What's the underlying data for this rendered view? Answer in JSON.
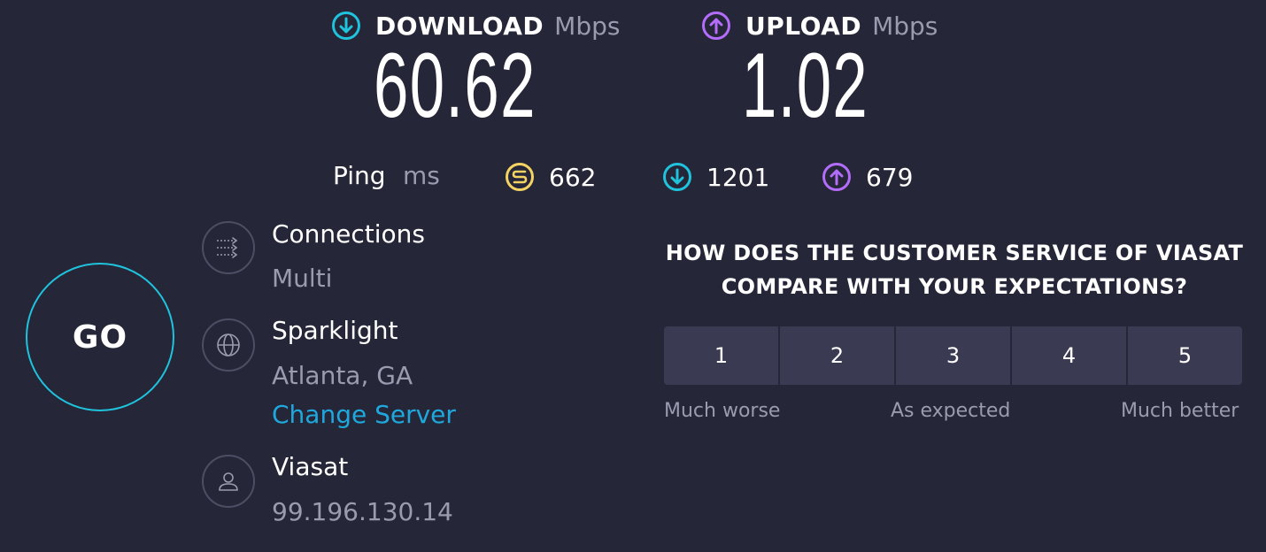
{
  "download": {
    "label": "DOWNLOAD",
    "unit": "Mbps",
    "value": "60.62",
    "icon": "download-arrow-icon",
    "color": "#1fc3dc"
  },
  "upload": {
    "label": "UPLOAD",
    "unit": "Mbps",
    "value": "1.02",
    "icon": "upload-arrow-icon",
    "color": "#b46dfb"
  },
  "ping": {
    "label": "Ping",
    "unit": "ms",
    "idle": {
      "value": "662",
      "icon": "ping-idle-icon",
      "color": "#f3d462"
    },
    "download": {
      "value": "1201",
      "icon": "ping-download-icon",
      "color": "#1fc3dc"
    },
    "upload": {
      "value": "679",
      "icon": "ping-upload-icon",
      "color": "#b46dfb"
    }
  },
  "go_button": {
    "label": "GO",
    "color": "#1fc3dc"
  },
  "connections": {
    "title": "Connections",
    "value": "Multi",
    "icon": "connections-icon"
  },
  "server": {
    "title": "Sparklight",
    "location": "Atlanta, GA",
    "change_label": "Change Server",
    "icon": "globe-icon"
  },
  "provider": {
    "title": "Viasat",
    "ip": "99.196.130.14",
    "icon": "user-icon"
  },
  "survey": {
    "question_line1": "HOW DOES THE CUSTOMER SERVICE OF VIASAT",
    "question_line2": "COMPARE WITH YOUR EXPECTATIONS?",
    "options": [
      "1",
      "2",
      "3",
      "4",
      "5"
    ],
    "low_label": "Much worse",
    "mid_label": "As expected",
    "high_label": "Much better"
  },
  "colors": {
    "background": "#262639",
    "muted": "#9b9bb0",
    "link": "#1fa8dc",
    "button_bg": "#3a3a52"
  }
}
